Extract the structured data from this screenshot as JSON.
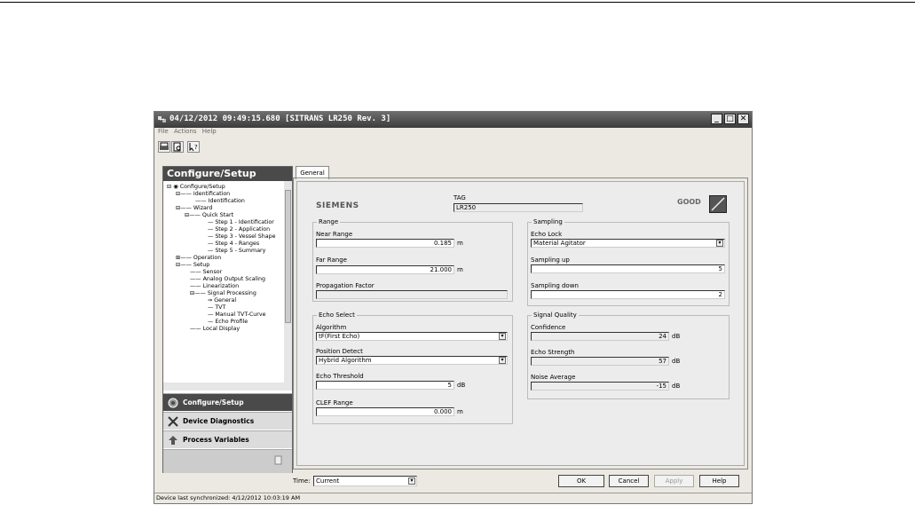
{
  "window": {
    "title": "04/12/2012 09:49:15.680 [SITRANS LR250 Rev. 3]",
    "menu": [
      "File",
      "Actions",
      "Help"
    ],
    "minimize": "_",
    "maximize": "□",
    "close": "✕"
  },
  "nav": {
    "header": "Configure/Setup",
    "tree": [
      "Configure/Setup",
      "Identification",
      "Identification",
      "Wizard",
      "Quick Start",
      "Step 1 - Identificatior",
      "Step 2 - Application",
      "Step 3 - Vessel Shape",
      "Step 4 - Ranges",
      "Step 5 - Summary",
      "Operation",
      "Setup",
      "Sensor",
      "Analog Output Scaling",
      "Linearization",
      "Signal Processing",
      "General",
      "TVT",
      "Manual TVT-Curve",
      "Echo Profile",
      "Local Display"
    ],
    "buttons": [
      "Configure/Setup",
      "Device Diagnostics",
      "Process Variables"
    ]
  },
  "tab": {
    "label": "General"
  },
  "general": {
    "brand": "SIEMENS",
    "tag_label": "TAG",
    "tag_value": "LR250",
    "status": "GOOD",
    "range": {
      "title": "Range",
      "near_label": "Near Range",
      "near_value": "0.185",
      "near_unit": "m",
      "far_label": "Far Range",
      "far_value": "21.000",
      "far_unit": "m",
      "prop_label": "Propagation Factor",
      "prop_value": ""
    },
    "sampling": {
      "title": "Sampling",
      "echo_lock_label": "Echo Lock",
      "echo_lock_value": "Material Agitator",
      "up_label": "Sampling up",
      "up_value": "5",
      "down_label": "Sampling down",
      "down_value": "2"
    },
    "echo_select": {
      "title": "Echo Select",
      "algorithm_label": "Algorithm",
      "algorithm_value": "tF(First Echo)",
      "position_label": "Position Detect",
      "position_value": "Hybrid Algorithm",
      "threshold_label": "Echo Threshold",
      "threshold_value": "5",
      "threshold_unit": "dB",
      "clef_label": "CLEF Range",
      "clef_value": "0.000",
      "clef_unit": "m"
    },
    "signal_quality": {
      "title": "Signal Quality",
      "confidence_label": "Confidence",
      "confidence_value": "24",
      "confidence_unit": "dB",
      "strength_label": "Echo Strength",
      "strength_value": "57",
      "strength_unit": "dB",
      "noise_label": "Noise Average",
      "noise_value": "-15",
      "noise_unit": "dB"
    }
  },
  "bottom": {
    "time_label": "Time:",
    "time_value": "Current",
    "ok": "OK",
    "cancel": "Cancel",
    "apply": "Apply",
    "help": "Help"
  },
  "statusbar": "Device last synchronized: 4/12/2012 10:03:19 AM"
}
